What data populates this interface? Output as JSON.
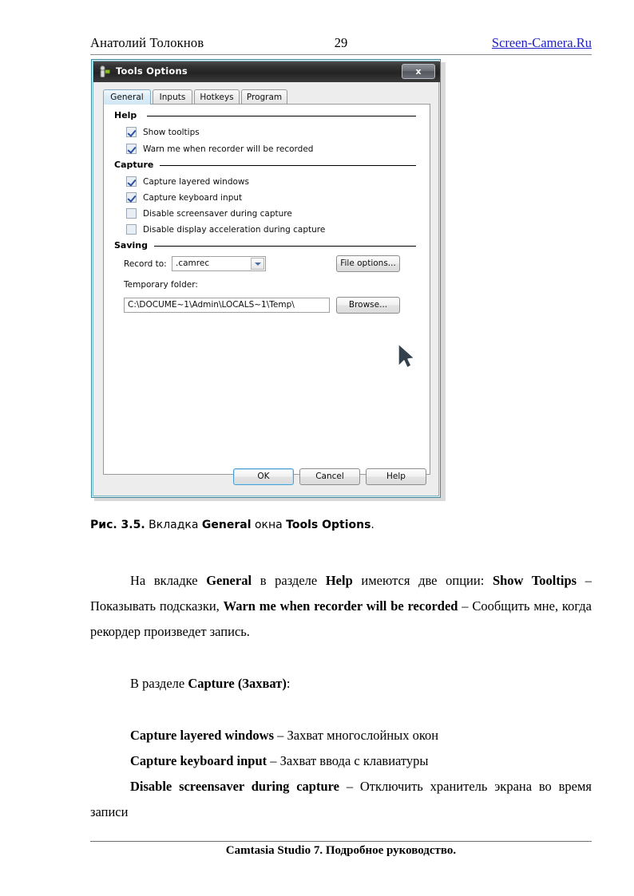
{
  "page_header": {
    "author": "Анатолий Толокнов",
    "page_number": "29",
    "site_link": "Screen-Camera.Ru"
  },
  "dialog": {
    "title": "Tools Options",
    "close_label": "x",
    "tabs": [
      {
        "label": "General",
        "active": true
      },
      {
        "label": "Inputs",
        "active": false
      },
      {
        "label": "Hotkeys",
        "active": false
      },
      {
        "label": "Program",
        "active": false
      }
    ],
    "groups": [
      {
        "title": "Help",
        "checkboxes": [
          {
            "label": "Show tooltips",
            "checked": true
          },
          {
            "label": "Warn me when recorder will be recorded",
            "checked": true
          }
        ]
      },
      {
        "title": "Capture",
        "checkboxes": [
          {
            "label": "Capture layered windows",
            "checked": true
          },
          {
            "label": "Capture keyboard input",
            "checked": true
          },
          {
            "label": "Disable screensaver during capture",
            "checked": false
          },
          {
            "label": "Disable display acceleration during capture",
            "checked": false
          }
        ]
      },
      {
        "title": "Saving",
        "record_to_label": "Record to:",
        "record_to_value": ".camrec",
        "file_options_button": "File options...",
        "temp_folder_label": "Temporary folder:",
        "temp_folder_value": "C:\\DOCUME~1\\Admin\\LOCALS~1\\Temp\\",
        "browse_button": "Browse..."
      }
    ],
    "footer_buttons": {
      "ok": "OK",
      "cancel": "Cancel",
      "help": "Help"
    }
  },
  "figure_caption": {
    "number": "Рис. 3.5.",
    "text_1": " Вкладка ",
    "bold_1": "General",
    "text_2": " окна ",
    "bold_2": "Tools Options",
    "text_3": "."
  },
  "body": {
    "para1": {
      "t1": "На вкладке ",
      "b1": "General",
      "t2": " в разделе ",
      "b2": "Help",
      "t3": " имеются две опции: ",
      "b3": "Show Tooltips",
      "t4": " – Показывать подсказки, ",
      "b4": "Warn me when recorder will be recorded",
      "t5": " – Сообщить мне, когда рекордер произведет запись."
    },
    "para2": {
      "t1": "В разделе ",
      "b1": "Capture (Захват)",
      "t2": ":"
    },
    "items": [
      {
        "bold": "Capture layered windows",
        "text": " – Захват многослойных окон"
      },
      {
        "bold": "Capture keyboard input",
        "text": " – Захват ввода с клавиатуры"
      },
      {
        "bold": "Disable screensaver during capture",
        "text": " – Отключить хранитель экрана во время записи"
      }
    ]
  },
  "footer": {
    "text": "Camtasia Studio 7. Подробное руководство."
  },
  "colors": {
    "link": "#2020c8",
    "dialog_border": "#3b8a9e",
    "titlebar": "#2b2b2b",
    "tab_active": "#cfe6f4",
    "check_mark": "#2b4f9e"
  }
}
